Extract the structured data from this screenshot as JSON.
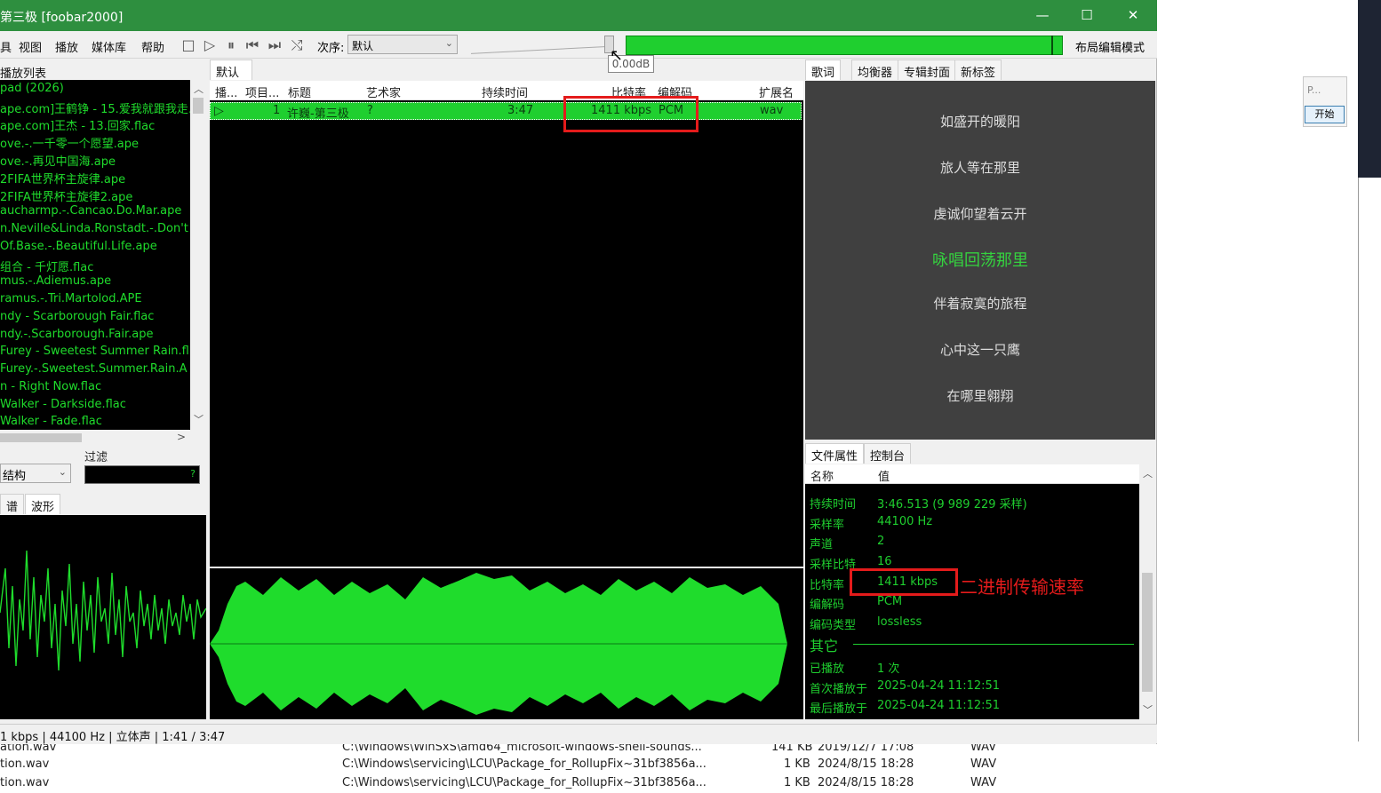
{
  "window": {
    "title": "第三极  [foobar2000]",
    "minimize": "—",
    "maximize": "☐",
    "close": "✕"
  },
  "menu": [
    "具",
    "视图",
    "播放",
    "媒体库",
    "帮助"
  ],
  "toolbar": {
    "order_label": "次序:",
    "order_value": "默认",
    "volume_tip": "0.00dB",
    "layout_mode": "布局编辑模式"
  },
  "library": {
    "header": "播放列表",
    "items": [
      "pad (2026)",
      "ape.com]王鹤铮 - 15.爱我就跟我走.f",
      "ape.com]王杰 - 13.回家.flac",
      "ove.-.一千零一个愿望.ape",
      "ove.-.再见中国海.ape",
      "2FIFA世界杯主旋律.ape",
      "2FIFA世界杯主旋律2.ape",
      "aucharmp.-.Cancao.Do.Mar.ape",
      "n.Neville&Linda.Ronstadt.-.Don't",
      "Of.Base.-.Beautiful.Life.ape",
      "组合 - 千灯愿.flac",
      "mus.-.Adiemus.ape",
      "ramus.-.Tri.Martolod.APE",
      "ndy - Scarborough Fair.flac",
      "ndy.-.Scarborough.Fair.ape",
      "Furey - Sweetest Summer Rain.fl",
      "Furey.-.Sweetest.Summer.Rain.A",
      "n - Right Now.flac",
      "Walker - Darkside.flac",
      "Walker - Fade.flac"
    ],
    "filter_label": "过滤",
    "struct_label": "结构",
    "spec_tab": "谱",
    "wave_tab": "波形"
  },
  "playlist": {
    "tab": "默认",
    "columns": [
      "播...",
      "项目...",
      "标题",
      "艺术家",
      "持续时间",
      "比特率",
      "编解码",
      "扩展名"
    ],
    "row": {
      "index": "1",
      "title": "许巍-第三极",
      "artist": "?",
      "duration": "3:47",
      "bitrate": "1411 kbps",
      "codec": "PCM",
      "ext": "wav"
    }
  },
  "right_tabs": [
    "歌词",
    "均衡器",
    "专辑封面",
    "新标签"
  ],
  "lyrics": [
    "如盛开的暖阳",
    "旅人等在那里",
    "虔诚仰望着云开",
    "咏唱回荡那里",
    "伴着寂寞的旅程",
    "心中这一只鹰",
    "在哪里翱翔"
  ],
  "properties": {
    "tabs": [
      "文件属性",
      "控制台"
    ],
    "header": [
      "名称",
      "值"
    ],
    "rows": [
      {
        "k": "持续时间",
        "v": "3:46.513 (9 989 229 采样)"
      },
      {
        "k": "采样率",
        "v": "44100 Hz"
      },
      {
        "k": "声道",
        "v": "2"
      },
      {
        "k": "采样比特",
        "v": "16"
      },
      {
        "k": "比特率",
        "v": "1411 kbps"
      },
      {
        "k": "编解码",
        "v": "PCM"
      },
      {
        "k": "编码类型",
        "v": "lossless"
      }
    ],
    "section_other": "其它",
    "rows2": [
      {
        "k": "已播放",
        "v": "1 次"
      },
      {
        "k": "首次播放于",
        "v": "2025-04-24 11:12:51"
      },
      {
        "k": "最后播放于",
        "v": "2025-04-24 11:12:51"
      }
    ]
  },
  "status": "1 kbps | 44100 Hz | 立体声 | 1:41 / 3:47",
  "annotation": "二进制传输速率",
  "background_files": [
    {
      "name": "ation.wav",
      "path": "C:\\Windows\\WinSxS\\amd64_microsoft-windows-shell-sounds...",
      "size": "141 KB",
      "date": "2019/12/7 17:08",
      "type": "WAV"
    },
    {
      "name": "tion.wav",
      "path": "C:\\Windows\\servicing\\LCU\\Package_for_RollupFix~31bf3856a...",
      "size": "1 KB",
      "date": "2024/8/15 18:28",
      "type": "WAV"
    },
    {
      "name": "tion.wav",
      "path": "C:\\Windows\\servicing\\LCU\\Package_for_RollupFix~31bf3856a...",
      "size": "1 KB",
      "date": "2024/8/15 18:28",
      "type": "WAV"
    }
  ],
  "ext_app": {
    "mini_label": "P...",
    "start_button": "开始"
  },
  "colors": {
    "title_green": "#2e8f3f",
    "fg_green": "#1fdc2c",
    "highlight_red": "#e41b1b"
  }
}
